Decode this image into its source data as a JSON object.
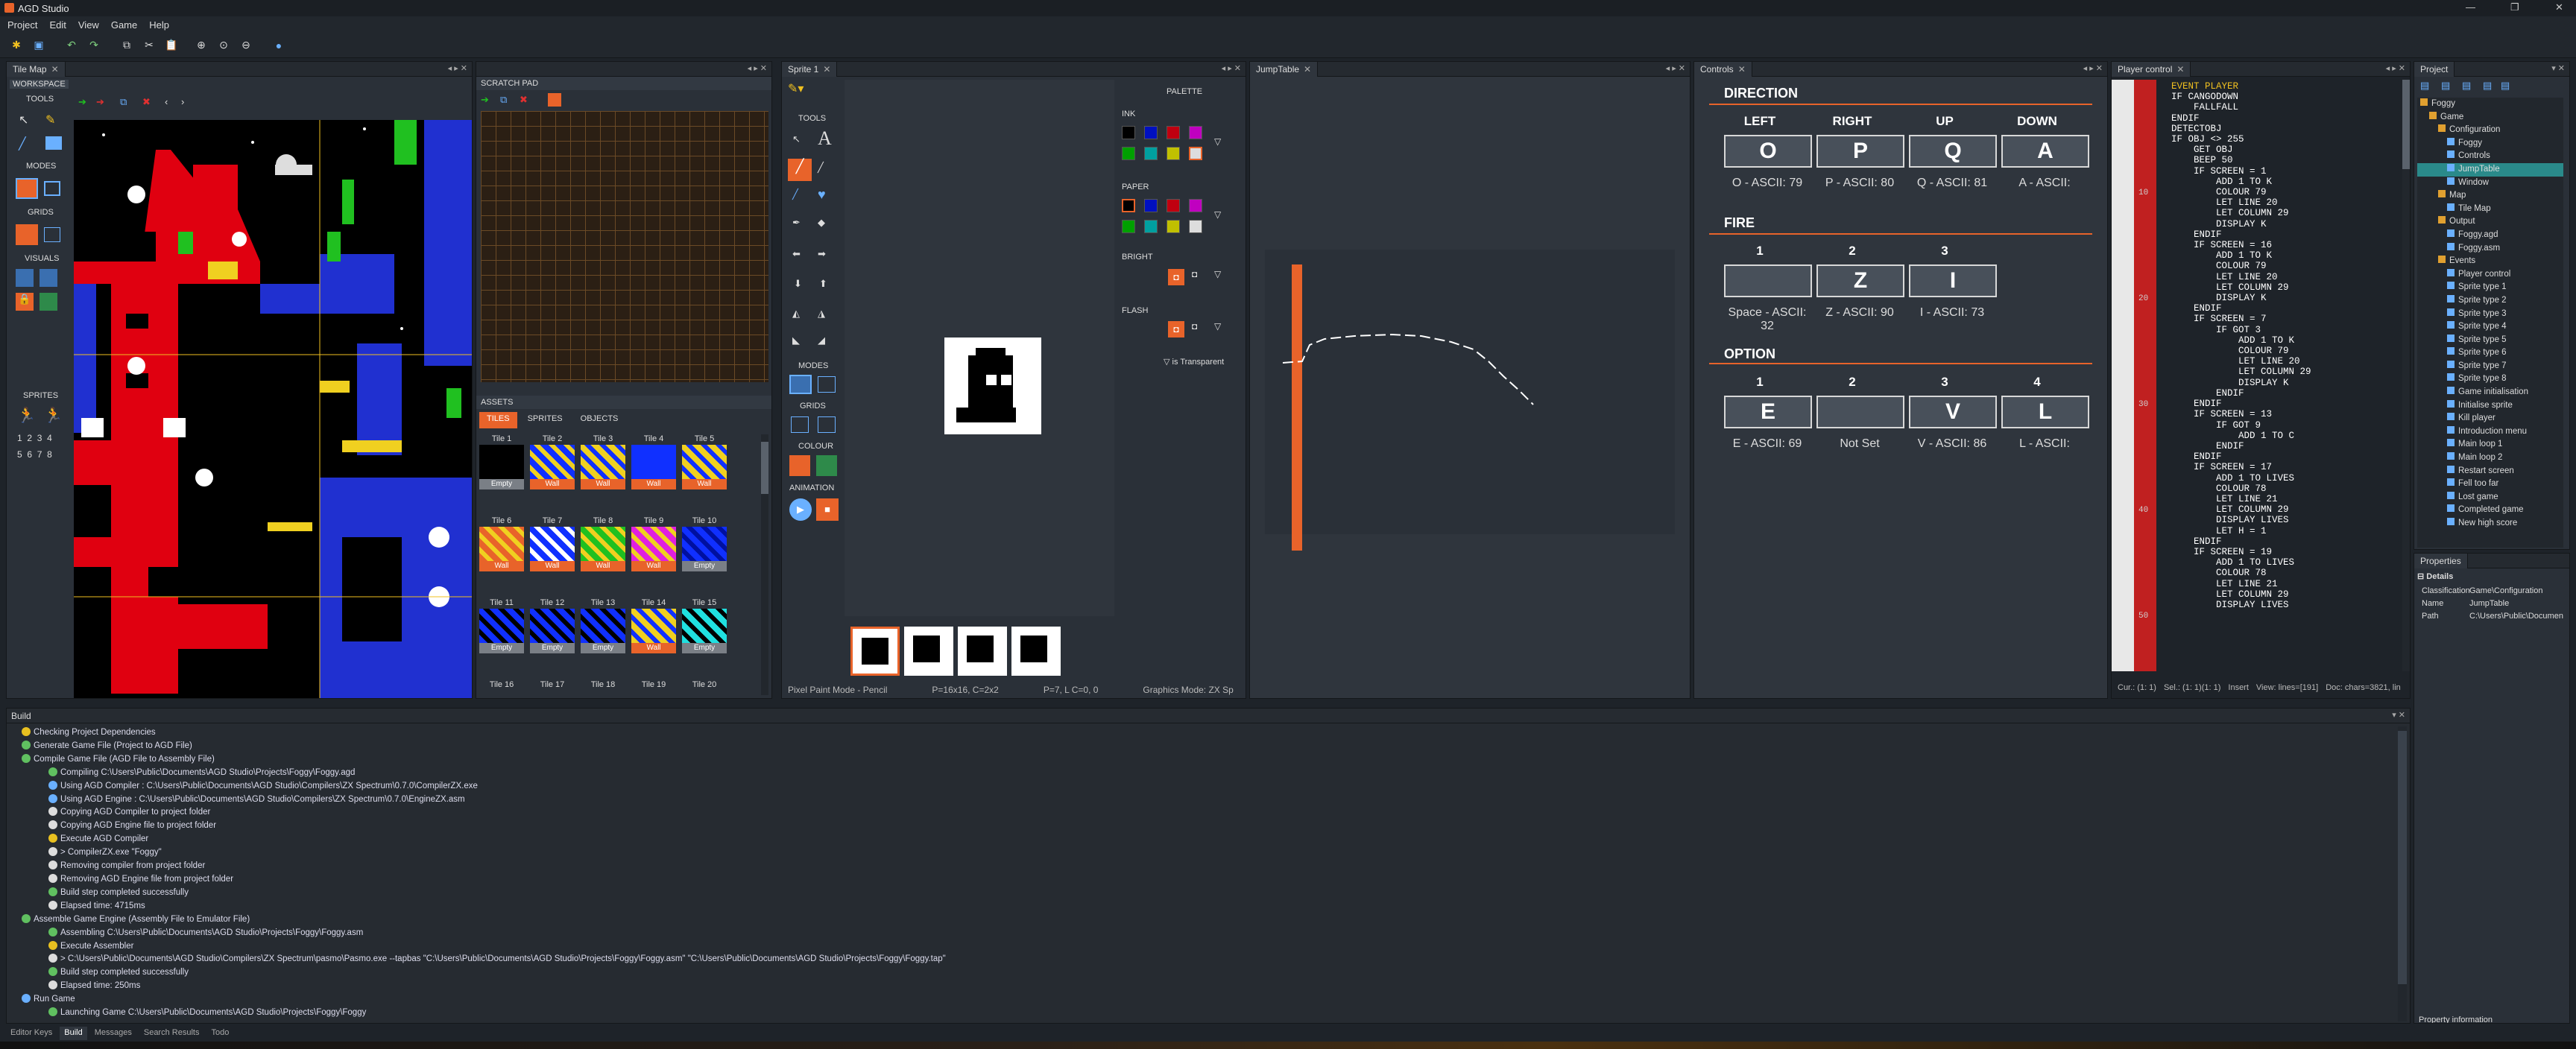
{
  "app": {
    "title": "AGD Studio"
  },
  "menu": [
    "Project",
    "Edit",
    "View",
    "Game",
    "Help"
  ],
  "tilemap": {
    "tab": "Tile Map",
    "workspace_label": "WORKSPACE",
    "tools": "TOOLS",
    "modes": "MODES",
    "grids": "GRIDS",
    "visuals": "VISUALS",
    "sprites": "SPRITES",
    "sprite_nums": [
      "1",
      "2",
      "3",
      "4",
      "5",
      "6",
      "7",
      "8"
    ]
  },
  "scratch": {
    "title": "SCRATCH PAD"
  },
  "assets": {
    "title": "ASSETS",
    "tabs": [
      "TILES",
      "SPRITES",
      "OBJECTS"
    ],
    "tiles": [
      {
        "name": "Tile 1",
        "tag": "Empty"
      },
      {
        "name": "Tile 2",
        "tag": "Wall"
      },
      {
        "name": "Tile 3",
        "tag": "Wall"
      },
      {
        "name": "Tile 4",
        "tag": "Wall"
      },
      {
        "name": "Tile 5",
        "tag": "Wall"
      },
      {
        "name": "Tile 6",
        "tag": "Wall"
      },
      {
        "name": "Tile 7",
        "tag": "Wall"
      },
      {
        "name": "Tile 8",
        "tag": "Wall"
      },
      {
        "name": "Tile 9",
        "tag": "Wall"
      },
      {
        "name": "Tile 10",
        "tag": "Empty"
      },
      {
        "name": "Tile 11",
        "tag": "Empty"
      },
      {
        "name": "Tile 12",
        "tag": "Empty"
      },
      {
        "name": "Tile 13",
        "tag": "Empty"
      },
      {
        "name": "Tile 14",
        "tag": "Wall"
      },
      {
        "name": "Tile 15",
        "tag": "Empty"
      },
      {
        "name": "Tile 16",
        "tag": ""
      },
      {
        "name": "Tile 17",
        "tag": ""
      },
      {
        "name": "Tile 18",
        "tag": ""
      },
      {
        "name": "Tile 19",
        "tag": ""
      },
      {
        "name": "Tile 20",
        "tag": ""
      }
    ]
  },
  "sprite": {
    "tab": "Sprite 1",
    "tools": "TOOLS",
    "modes": "MODES",
    "grids": "GRIDS",
    "colour": "COLOUR",
    "animation": "ANIMATION",
    "palette": "PALETTE",
    "ink": "INK",
    "paper": "PAPER",
    "bright": "BRIGHT",
    "flash": "FLASH",
    "transparent": "is Transparent",
    "status": [
      "Pixel Paint Mode - Pencil",
      "P=16x16, C=2x2",
      "P=7, L C=0, 0",
      "Graphics Mode: ZX Sp"
    ]
  },
  "jump": {
    "tab": "JumpTable"
  },
  "controls": {
    "tab": "Controls",
    "direction": "DIRECTION",
    "fire": "FIRE",
    "option": "OPTION",
    "dir_headers": [
      "LEFT",
      "RIGHT",
      "UP",
      "DOWN"
    ],
    "dir_keys": [
      "O",
      "P",
      "Q",
      "A"
    ],
    "dir_labels": [
      "O - ASCII: 79",
      "P - ASCII: 80",
      "Q - ASCII: 81",
      "A - ASCII:"
    ],
    "fire_headers": [
      "1",
      "2",
      "3"
    ],
    "fire_keys": [
      "",
      "Z",
      "I"
    ],
    "fire_labels": [
      "Space - ASCII: 32",
      "Z - ASCII: 90",
      "I - ASCII: 73"
    ],
    "opt_headers": [
      "1",
      "2",
      "3",
      "4"
    ],
    "opt_keys": [
      "E",
      "",
      "V",
      "L"
    ],
    "opt_labels": [
      "E - ASCII: 69",
      "Not Set",
      "V - ASCII: 86",
      "L - ASCII:"
    ]
  },
  "player": {
    "tab": "Player control",
    "code": [
      "EVENT PLAYER",
      "IF CANGODOWN",
      "    FALLFALL",
      "ENDIF",
      "DETECTOBJ",
      "IF OBJ <> 255",
      "    GET OBJ",
      "    BEEP 50",
      "    IF SCREEN = 1",
      "        ADD 1 TO K",
      "        COLOUR 79",
      "        LET LINE 20",
      "        LET COLUMN 29",
      "        DISPLAY K",
      "    ENDIF",
      "    IF SCREEN = 16",
      "        ADD 1 TO K",
      "        COLOUR 79",
      "        LET LINE 20",
      "        LET COLUMN 29",
      "        DISPLAY K",
      "    ENDIF",
      "    IF SCREEN = 7",
      "        IF GOT 3",
      "            ADD 1 TO K",
      "            COLOUR 79",
      "            LET LINE 20",
      "            LET COLUMN 29",
      "            DISPLAY K",
      "        ENDIF",
      "    ENDIF",
      "    IF SCREEN = 13",
      "        IF GOT 9",
      "            ADD 1 TO C",
      "        ENDIF",
      "    ENDIF",
      "    IF SCREEN = 17",
      "        ADD 1 TO LIVES",
      "        COLOUR 78",
      "        LET LINE 21",
      "        LET COLUMN 29",
      "        DISPLAY LIVES",
      "        LET H = 1",
      "    ENDIF",
      "    IF SCREEN = 19",
      "        ADD 1 TO LIVES",
      "        COLOUR 78",
      "        LET LINE 21",
      "        LET COLUMN 29",
      "        DISPLAY LIVES"
    ],
    "gutter": [
      "10",
      "20",
      "30",
      "40",
      "50"
    ],
    "status": [
      "Cur.: (1: 1)",
      "Sel.: (1: 1)(1: 1)",
      "Insert",
      "View: lines=[191]",
      "Doc: chars=3821, lin"
    ]
  },
  "project": {
    "tab": "Project",
    "items": [
      "Foggy",
      "Game",
      "Configuration",
      "Foggy",
      "Controls",
      "JumpTable",
      "Window",
      "Map",
      "Tile Map",
      "Output",
      "Foggy.agd",
      "Foggy.asm",
      "Events",
      "Player control",
      "Sprite type 1",
      "Sprite type 2",
      "Sprite type 3",
      "Sprite type 4",
      "Sprite type 5",
      "Sprite type 6",
      "Sprite type 7",
      "Sprite type 8",
      "Game initialisation",
      "Initialise sprite",
      "Kill player",
      "Introduction menu",
      "Main loop 1",
      "Main loop 2",
      "Restart screen",
      "Fell too far",
      "Lost game",
      "Completed game",
      "New high score"
    ]
  },
  "properties": {
    "title": "Properties",
    "group": "Details",
    "rows": [
      [
        "Classification",
        "Game\\Configuration"
      ],
      [
        "Name",
        "JumpTable"
      ],
      [
        "Path",
        "C:\\Users\\Public\\Documen"
      ]
    ],
    "footer": "Property information"
  },
  "build": {
    "title": "Build",
    "lines": [
      "Checking Project Dependencies",
      "Generate Game File (Project to AGD File)",
      "Compile Game File (AGD File to Assembly File)",
      "Compiling C:\\Users\\Public\\Documents\\AGD Studio\\Projects\\Foggy\\Foggy.agd",
      "Using AGD Compiler : C:\\Users\\Public\\Documents\\AGD Studio\\Compilers\\ZX Spectrum\\0.7.0\\CompilerZX.exe",
      "Using AGD Engine : C:\\Users\\Public\\Documents\\AGD Studio\\Compilers\\ZX Spectrum\\0.7.0\\EngineZX.asm",
      "Copying AGD Compiler to project folder",
      "Copying AGD Engine file to project folder",
      "Execute AGD Compiler",
      "> CompilerZX.exe \"Foggy\"",
      "Removing compiler from project folder",
      "Removing AGD Engine file from project folder",
      "Build step completed successfully",
      "Elapsed time: 4715ms",
      "Assemble Game Engine (Assembly File to Emulator File)",
      "Assembling C:\\Users\\Public\\Documents\\AGD Studio\\Projects\\Foggy\\Foggy.asm",
      "Execute Assembler",
      "> C:\\Users\\Public\\Documents\\AGD Studio\\Compilers\\ZX Spectrum\\pasmo\\Pasmo.exe --tapbas \"C:\\Users\\Public\\Documents\\AGD Studio\\Projects\\Foggy\\Foggy.asm\" \"C:\\Users\\Public\\Documents\\AGD Studio\\Projects\\Foggy\\Foggy.tap\"",
      "Build step completed successfully",
      "Elapsed time: 250ms",
      "Run Game",
      "Launching Game C:\\Users\\Public\\Documents\\AGD Studio\\Projects\\Foggy\\Foggy"
    ],
    "tabs": [
      "Editor Keys",
      "Build",
      "Messages",
      "Search Results",
      "Todo"
    ]
  },
  "colors": {
    "accent": "#e8632a",
    "bg": "#1e2329",
    "panel": "#2a3038"
  }
}
